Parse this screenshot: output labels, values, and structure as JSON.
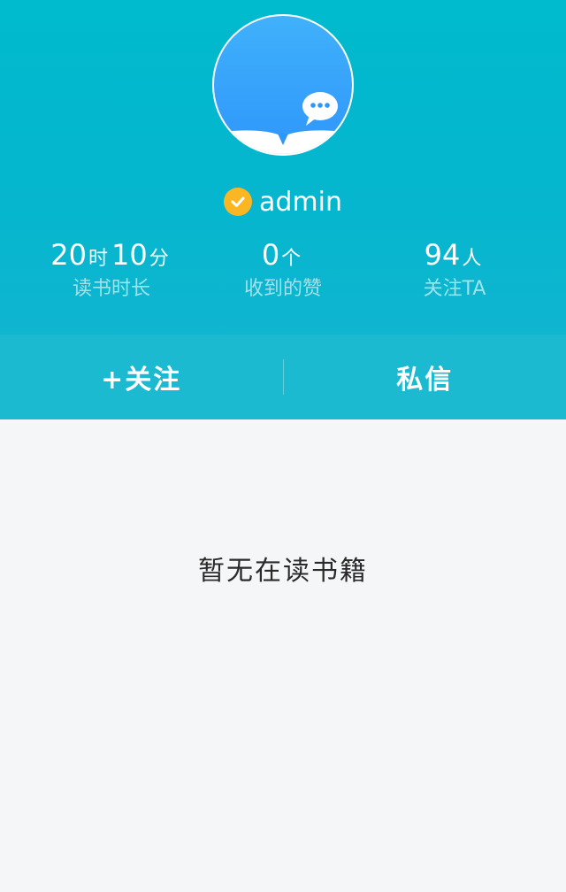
{
  "profile": {
    "username": "admin",
    "avatar_icon": "chat-bubble-book-logo",
    "verified_icon": "check-icon",
    "verified_color": "#fbb624"
  },
  "stats": {
    "reading_time": {
      "hours": "20",
      "hours_unit": "时",
      "minutes": "10",
      "minutes_unit": "分",
      "label": "读书时长"
    },
    "likes": {
      "value": "0",
      "unit": "个",
      "label": "收到的赞"
    },
    "followers": {
      "value": "94",
      "unit": "人",
      "label": "关注TA"
    }
  },
  "actions": {
    "follow_label": "+关注",
    "message_label": "私信"
  },
  "empty_state": {
    "message": "暂无在读书籍"
  },
  "colors": {
    "header": "#05b6ce",
    "action_bar": "#1cbad0",
    "label": "#9ee3ec",
    "background": "#f5f6f8"
  }
}
